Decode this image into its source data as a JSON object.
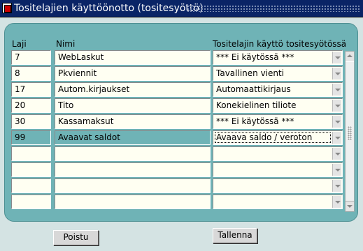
{
  "window": {
    "title": "Tositelajien käyttöönotto (tositesyöttö)"
  },
  "columns": {
    "laji": "Laji",
    "nimi": "Nimi",
    "kaytto": "Tositelajin käyttö tositesyötössä"
  },
  "rows": [
    {
      "laji": "7",
      "nimi": "WebLaskut",
      "kaytto": "*** Ei käytössä ***"
    },
    {
      "laji": "8",
      "nimi": "Pkviennit",
      "kaytto": "Tavallinen vienti"
    },
    {
      "laji": "17",
      "nimi": "Autom.kirjaukset",
      "kaytto": "Automaattikirjaus"
    },
    {
      "laji": "20",
      "nimi": "Tito",
      "kaytto": "Konekielinen tiliote"
    },
    {
      "laji": "30",
      "nimi": "Kassamaksut",
      "kaytto": "*** Ei käytössä ***"
    },
    {
      "laji": "99",
      "nimi": "Avaavat saldot",
      "kaytto": "Avaava saldo / veroton"
    },
    {
      "laji": "",
      "nimi": "",
      "kaytto": ""
    },
    {
      "laji": "",
      "nimi": "",
      "kaytto": ""
    },
    {
      "laji": "",
      "nimi": "",
      "kaytto": ""
    },
    {
      "laji": "",
      "nimi": "",
      "kaytto": ""
    }
  ],
  "selected_row": 5,
  "buttons": {
    "delete": "Poistu",
    "save": "Tallenna"
  },
  "colors": {
    "panel": "#6fb3b6",
    "titlebar": "#0a2466",
    "field": "#fffff2"
  },
  "icons": {
    "app": "form-window-icon",
    "dropdown": "chevron-down-icon"
  }
}
